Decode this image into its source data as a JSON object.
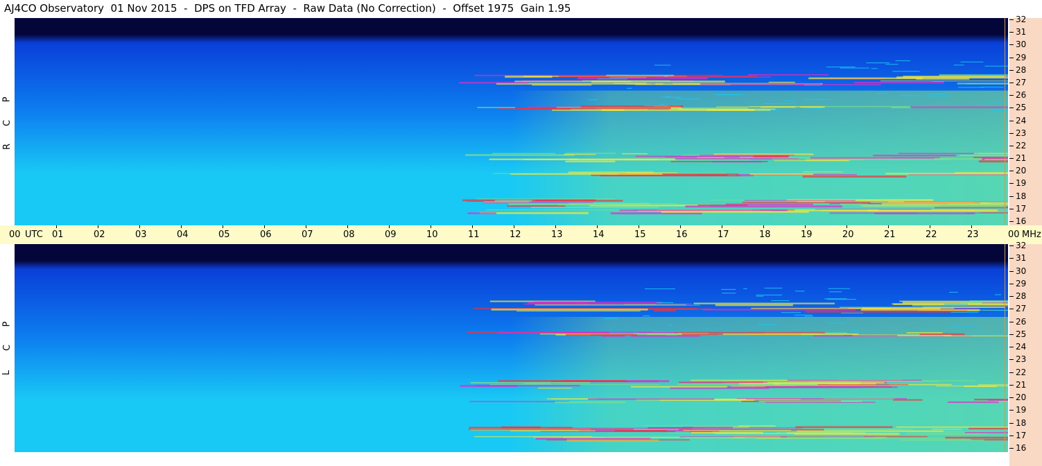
{
  "title": "AJ4CO Observatory  01 Nov 2015  -  DPS on TFD Array  -  Raw Data (No Correction)  -  Offset 1975  Gain 1.95",
  "top_panel": {
    "polarization_letters": [
      "R",
      "C",
      "P"
    ]
  },
  "bottom_panel": {
    "polarization_letters": [
      "L",
      "C",
      "P"
    ]
  },
  "time_axis": {
    "start_label": "00",
    "utc_label": "UTC",
    "hour_labels": [
      "01",
      "02",
      "03",
      "04",
      "05",
      "06",
      "07",
      "08",
      "09",
      "10",
      "11",
      "12",
      "13",
      "14",
      "15",
      "16",
      "17",
      "18",
      "19",
      "20",
      "21",
      "22",
      "23"
    ],
    "end_label": "00",
    "unit_label": "MHz"
  },
  "freq_axis": {
    "labels": [
      "32",
      "31",
      "30",
      "29",
      "28",
      "27",
      "26",
      "25",
      "24",
      "23",
      "22",
      "21",
      "20",
      "19",
      "18",
      "17",
      "16"
    ]
  },
  "colors": {
    "spectro_deep": "#04063a",
    "spectro_blue": "#0a3fd8",
    "spectro_mid": "#0d7ef0",
    "spectro_cyan": "#19c9f5",
    "spectro_green": "#7ee08a",
    "spectro_yellow": "#f3e83a",
    "spectro_red": "#f3323a",
    "spectro_magenta": "#e32cc8",
    "time_axis_bg": "#fffbc8",
    "freq_axis_bg": "#f9d9c4"
  }
}
